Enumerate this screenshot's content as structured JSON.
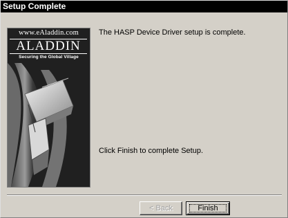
{
  "window": {
    "title": "Setup Complete"
  },
  "banner": {
    "url": "www.eAladdin.com",
    "logo": "ALADDIN",
    "tagline": "Securing the Global Village"
  },
  "message": {
    "status": "The HASP Device Driver setup is complete.",
    "instruction": "Click Finish to complete Setup."
  },
  "buttons": {
    "back": "< Back",
    "finish": "Finish"
  }
}
